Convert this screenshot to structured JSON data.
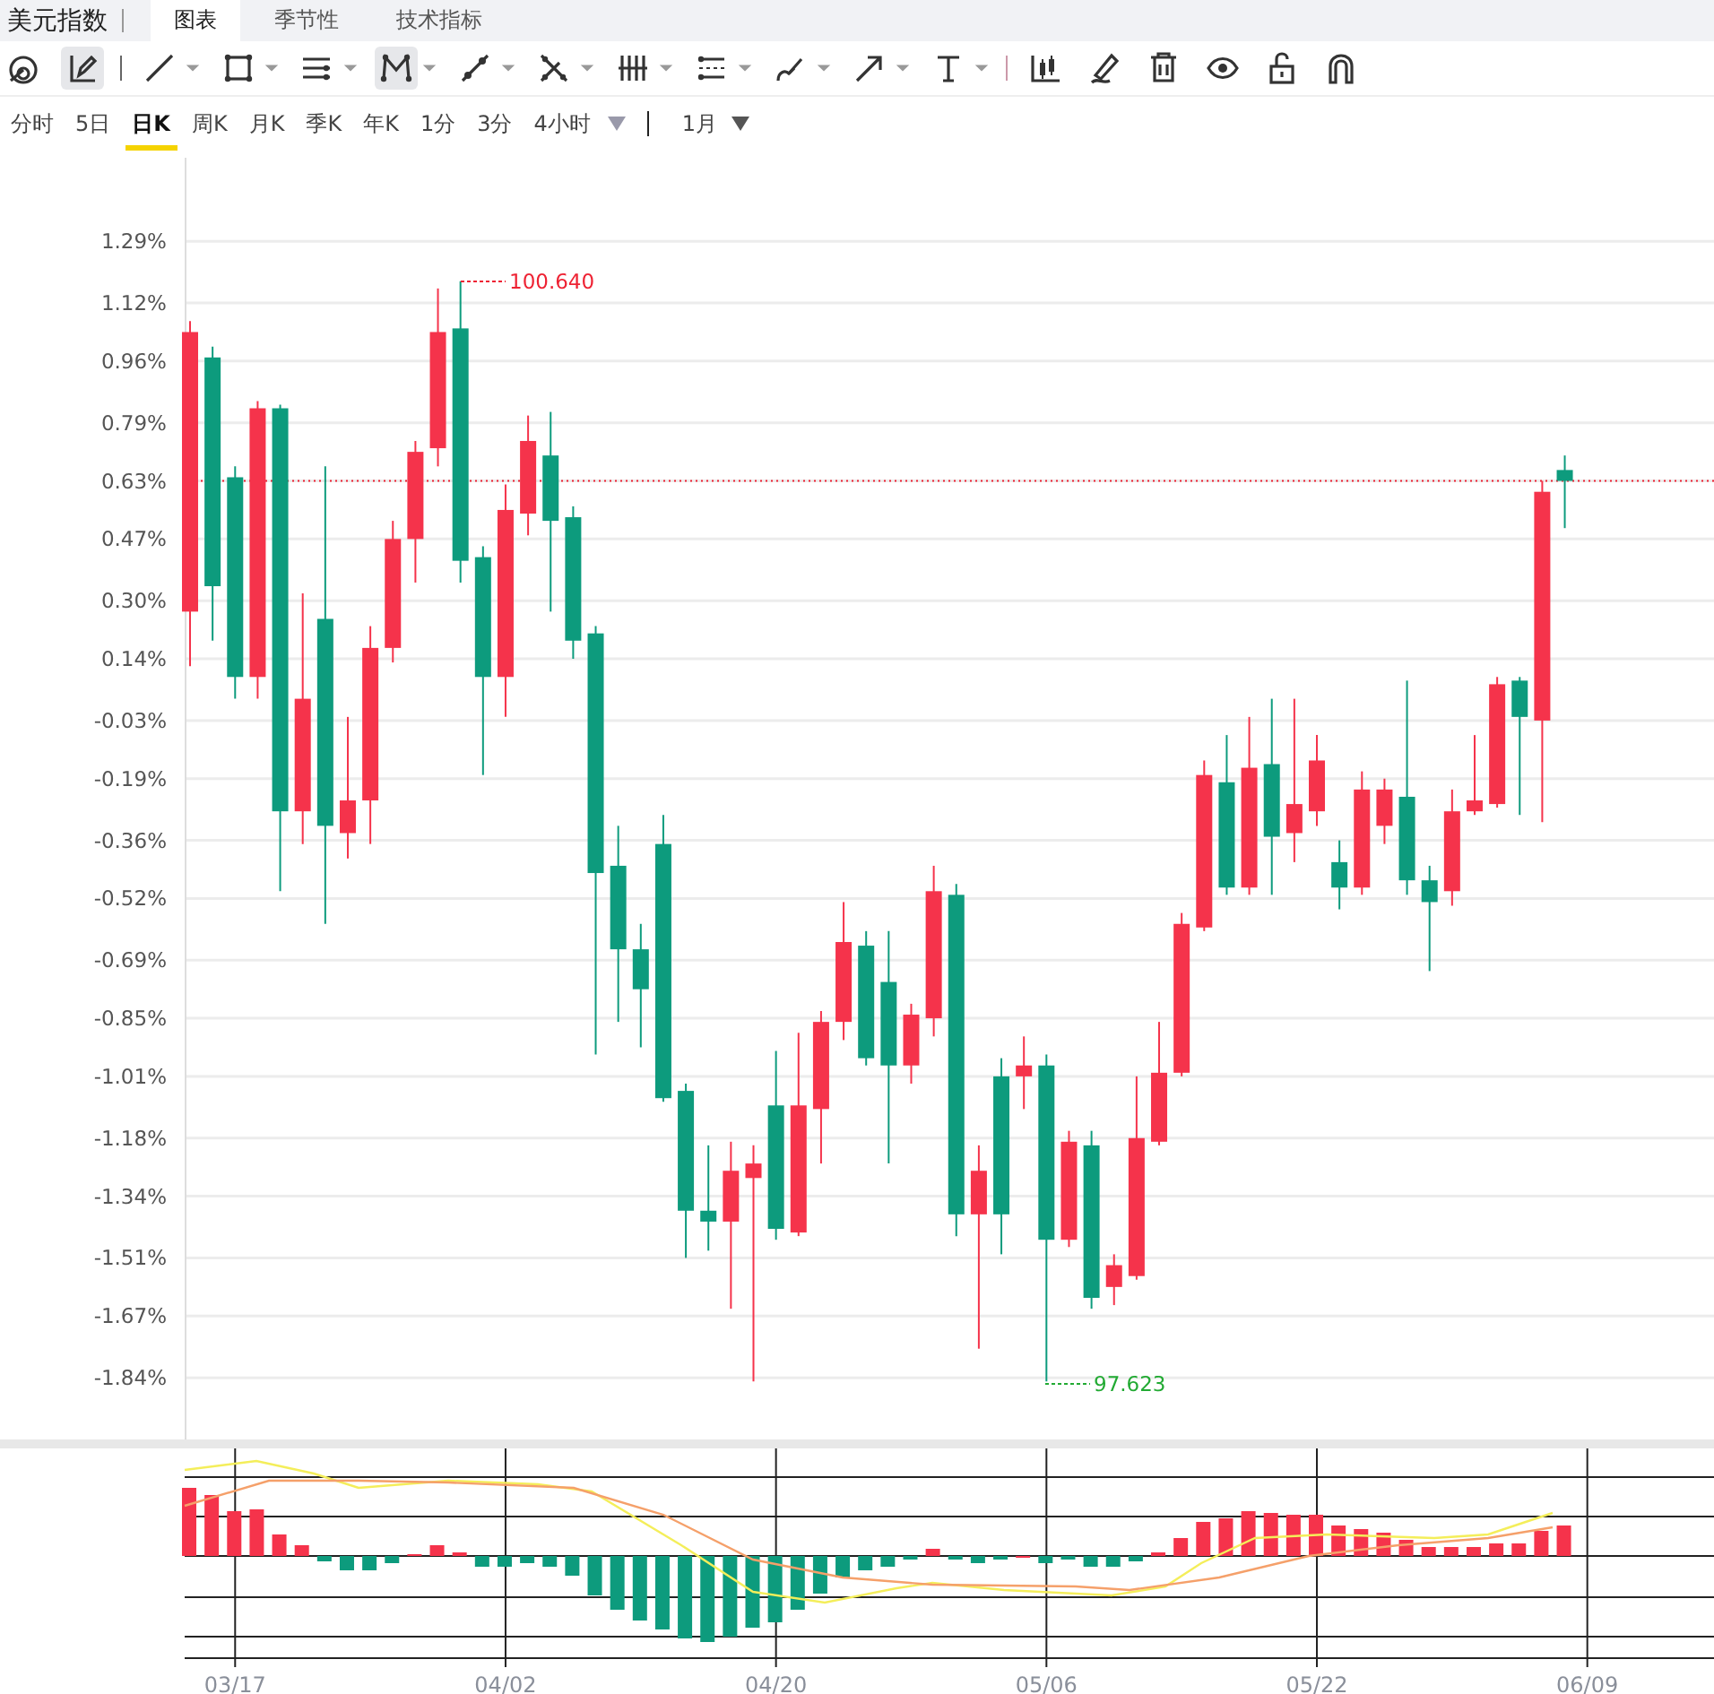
{
  "title": "美元指数",
  "tabs": [
    {
      "label": "图表",
      "selected": true
    },
    {
      "label": "季节性",
      "selected": false
    },
    {
      "label": "技术指标",
      "selected": false
    }
  ],
  "tools": [
    {
      "selected": false,
      "dropdown": false
    },
    {
      "selected": true,
      "dropdown": false
    },
    {
      "selected": false,
      "dropdown": true
    },
    {
      "selected": false,
      "dropdown": true
    },
    {
      "selected": false,
      "dropdown": true
    },
    {
      "selected": true,
      "dropdown": true
    },
    {
      "selected": false,
      "dropdown": true
    },
    {
      "selected": false,
      "dropdown": true
    },
    {
      "selected": false,
      "dropdown": true
    },
    {
      "selected": false,
      "dropdown": true
    },
    {
      "selected": false,
      "dropdown": true
    },
    {
      "selected": false,
      "dropdown": true
    },
    {
      "selected": false,
      "dropdown": true
    },
    {
      "selected": false,
      "dropdown": false
    },
    {
      "selected": false,
      "dropdown": false
    },
    {
      "selected": false,
      "dropdown": false
    },
    {
      "selected": false,
      "dropdown": false
    },
    {
      "selected": false,
      "dropdown": false
    },
    {
      "selected": false,
      "dropdown": false
    }
  ],
  "periods": [
    {
      "label": "分时",
      "selected": false
    },
    {
      "label": "5日",
      "selected": false
    },
    {
      "label": "日K",
      "selected": true
    },
    {
      "label": "周K",
      "selected": false
    },
    {
      "label": "月K",
      "selected": false
    },
    {
      "label": "季K",
      "selected": false
    },
    {
      "label": "年K",
      "selected": false
    },
    {
      "label": "1分",
      "selected": false
    },
    {
      "label": "3分",
      "selected": false
    },
    {
      "label": "4小时",
      "selected": false
    }
  ],
  "range": "1月",
  "chart": {
    "high_marker": "100.640",
    "low_marker": "97.623",
    "chart_data": {
      "type": "candlestick",
      "grid": true,
      "ylim": [
        -2.01,
        1.52
      ],
      "ref_lines": [
        {
          "axis": "y",
          "value": 0.63
        }
      ],
      "ohlc": [
        [
          0.27,
          1.07,
          0.12,
          1.04
        ],
        [
          0.97,
          1.0,
          0.19,
          0.34
        ],
        [
          0.64,
          0.67,
          0.03,
          0.09
        ],
        [
          0.09,
          0.85,
          0.03,
          0.83
        ],
        [
          0.83,
          0.84,
          -0.5,
          -0.28
        ],
        [
          -0.28,
          0.32,
          -0.37,
          0.03
        ],
        [
          0.25,
          0.67,
          -0.59,
          -0.32
        ],
        [
          -0.34,
          -0.02,
          -0.41,
          -0.25
        ],
        [
          -0.25,
          0.23,
          -0.37,
          0.17
        ],
        [
          0.17,
          0.52,
          0.13,
          0.47
        ],
        [
          0.47,
          0.74,
          0.35,
          0.71
        ],
        [
          0.72,
          1.16,
          0.67,
          1.04
        ],
        [
          1.05,
          1.18,
          0.35,
          0.41
        ],
        [
          0.42,
          0.45,
          -0.18,
          0.09
        ],
        [
          0.09,
          0.62,
          -0.02,
          0.55
        ],
        [
          0.54,
          0.81,
          0.48,
          0.74
        ],
        [
          0.7,
          0.82,
          0.27,
          0.52
        ],
        [
          0.53,
          0.56,
          0.14,
          0.19
        ],
        [
          0.21,
          0.23,
          -0.95,
          -0.45
        ],
        [
          -0.43,
          -0.32,
          -0.86,
          -0.66
        ],
        [
          -0.66,
          -0.59,
          -0.93,
          -0.77
        ],
        [
          -0.37,
          -0.29,
          -1.08,
          -1.07
        ],
        [
          -1.05,
          -1.03,
          -1.51,
          -1.38
        ],
        [
          -1.38,
          -1.2,
          -1.49,
          -1.41
        ],
        [
          -1.41,
          -1.19,
          -1.65,
          -1.27
        ],
        [
          -1.29,
          -1.2,
          -1.85,
          -1.25
        ],
        [
          -1.09,
          -0.94,
          -1.46,
          -1.43
        ],
        [
          -1.44,
          -0.89,
          -1.45,
          -1.09
        ],
        [
          -1.1,
          -0.83,
          -1.25,
          -0.86
        ],
        [
          -0.86,
          -0.53,
          -0.91,
          -0.64
        ],
        [
          -0.65,
          -0.61,
          -0.98,
          -0.96
        ],
        [
          -0.75,
          -0.61,
          -1.25,
          -0.98
        ],
        [
          -0.98,
          -0.81,
          -1.03,
          -0.84
        ],
        [
          -0.85,
          -0.43,
          -0.9,
          -0.5
        ],
        [
          -0.51,
          -0.48,
          -1.45,
          -1.39
        ],
        [
          -1.39,
          -1.2,
          -1.76,
          -1.27
        ],
        [
          -1.01,
          -0.96,
          -1.5,
          -1.39
        ],
        [
          -1.01,
          -0.9,
          -1.1,
          -0.98
        ],
        [
          -0.98,
          -0.95,
          -1.85,
          -1.46
        ],
        [
          -1.46,
          -1.16,
          -1.48,
          -1.19
        ],
        [
          -1.2,
          -1.16,
          -1.65,
          -1.62
        ],
        [
          -1.59,
          -1.5,
          -1.64,
          -1.53
        ],
        [
          -1.56,
          -1.01,
          -1.57,
          -1.18
        ],
        [
          -1.19,
          -0.86,
          -1.2,
          -1.0
        ],
        [
          -1.0,
          -0.56,
          -1.01,
          -0.59
        ],
        [
          -0.6,
          -0.14,
          -0.61,
          -0.18
        ],
        [
          -0.2,
          -0.07,
          -0.51,
          -0.49
        ],
        [
          -0.49,
          -0.02,
          -0.51,
          -0.16
        ],
        [
          -0.15,
          0.03,
          -0.51,
          -0.35
        ],
        [
          -0.34,
          0.03,
          -0.42,
          -0.26
        ],
        [
          -0.28,
          -0.07,
          -0.32,
          -0.14
        ],
        [
          -0.42,
          -0.36,
          -0.55,
          -0.49
        ],
        [
          -0.49,
          -0.17,
          -0.51,
          -0.22
        ],
        [
          -0.32,
          -0.19,
          -0.37,
          -0.22
        ],
        [
          -0.24,
          0.08,
          -0.51,
          -0.47
        ],
        [
          -0.47,
          -0.43,
          -0.72,
          -0.53
        ],
        [
          -0.5,
          -0.22,
          -0.54,
          -0.28
        ],
        [
          -0.28,
          -0.07,
          -0.29,
          -0.25
        ],
        [
          -0.26,
          0.09,
          -0.27,
          0.07
        ],
        [
          0.08,
          0.09,
          -0.29,
          -0.02
        ],
        [
          -0.03,
          0.63,
          -0.31,
          0.6
        ],
        [
          0.66,
          0.7,
          0.5,
          0.63
        ]
      ],
      "yticks": [
        {
          "value": 1.29,
          "label": "1.29%"
        },
        {
          "value": 1.12,
          "label": "1.12%"
        },
        {
          "value": 0.96,
          "label": "0.96%"
        },
        {
          "value": 0.79,
          "label": "0.79%"
        },
        {
          "value": 0.63,
          "label": "0.63%"
        },
        {
          "value": 0.47,
          "label": "0.47%"
        },
        {
          "value": 0.3,
          "label": "0.30%"
        },
        {
          "value": 0.14,
          "label": "0.14%"
        },
        {
          "value": -0.03,
          "label": "-0.03%"
        },
        {
          "value": -0.19,
          "label": "-0.19%"
        },
        {
          "value": -0.36,
          "label": "-0.36%"
        },
        {
          "value": -0.52,
          "label": "-0.52%"
        },
        {
          "value": -0.69,
          "label": "-0.69%"
        },
        {
          "value": -0.85,
          "label": "-0.85%"
        },
        {
          "value": -1.01,
          "label": "-1.01%"
        },
        {
          "value": -1.18,
          "label": "-1.18%"
        },
        {
          "value": -1.34,
          "label": "-1.34%"
        },
        {
          "value": -1.51,
          "label": "-1.51%"
        },
        {
          "value": -1.67,
          "label": "-1.67%"
        },
        {
          "value": -1.84,
          "label": "-1.84%"
        }
      ]
    }
  },
  "x_axis_labels": [
    "03/17",
    "04/02",
    "04/20",
    "05/06",
    "05/22",
    "06/09"
  ]
}
